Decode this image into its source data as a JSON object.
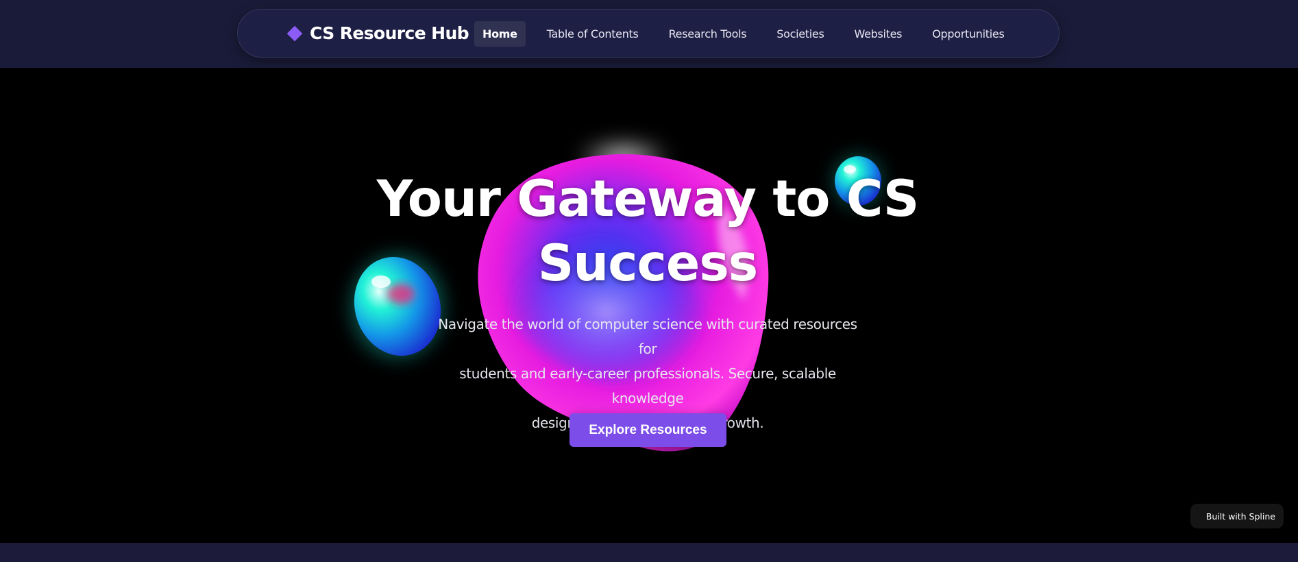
{
  "brand": {
    "name": "CS Resource Hub",
    "icon": "diamond-icon",
    "accent": "#8b5cf6"
  },
  "nav": {
    "items": [
      {
        "label": "Home",
        "active": true
      },
      {
        "label": "Table of Contents",
        "active": false
      },
      {
        "label": "Research Tools",
        "active": false
      },
      {
        "label": "Societies",
        "active": false
      },
      {
        "label": "Websites",
        "active": false
      },
      {
        "label": "Opportunities",
        "active": false
      }
    ]
  },
  "hero": {
    "headline_line1": "Your Gateway to CS",
    "headline_line2": "Success",
    "subtitle_line1": "Navigate the world of computer science with curated resources for",
    "subtitle_line2": "students and early-career professionals. Secure, scalable knowledge",
    "subtitle_line3": "designed to empower your growth.",
    "cta_label": "Explore Resources",
    "cta_color": "#7c4de8"
  },
  "badge": {
    "label": "Built with Spline"
  },
  "colors": {
    "header_bg": "#1a1b38",
    "hero_bg": "#000000",
    "blob_magenta": "#ff1ed8",
    "blob_cyan": "#18f0d0"
  }
}
